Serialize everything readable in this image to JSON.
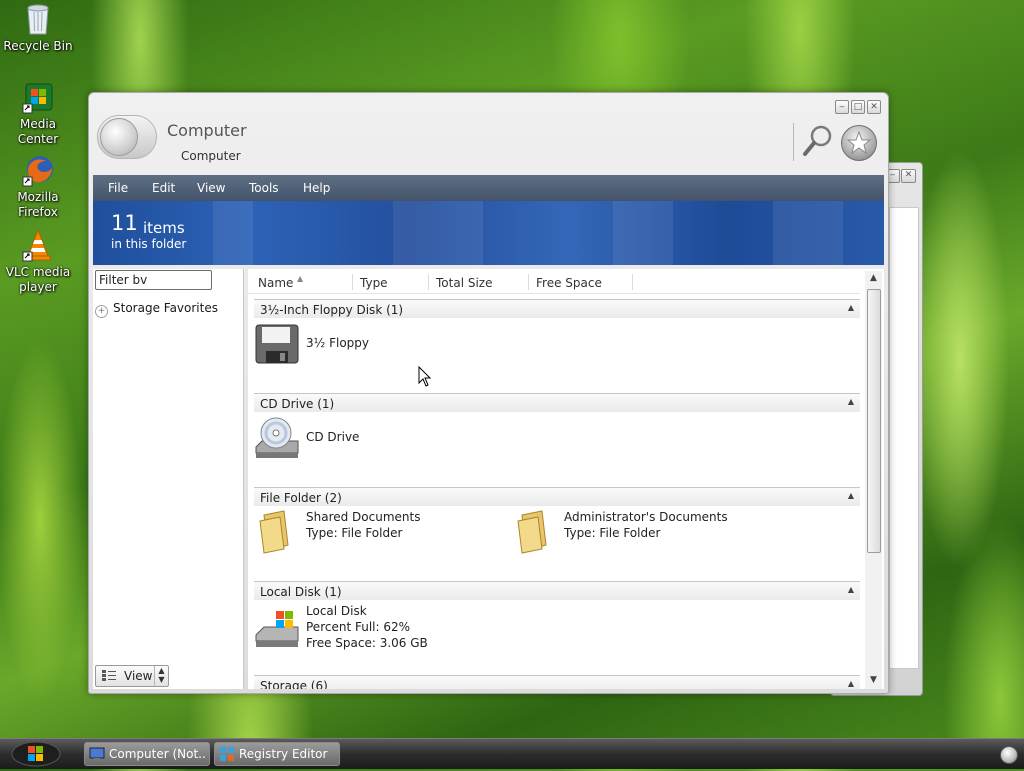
{
  "desktop": {
    "icons": [
      {
        "label": "Recycle Bin",
        "icon": "recycle-bin-icon"
      },
      {
        "label": "Media Center",
        "icon": "media-center-icon"
      },
      {
        "label": "Mozilla Firefox",
        "icon": "firefox-icon"
      },
      {
        "label": "VLC media player",
        "icon": "vlc-icon"
      }
    ]
  },
  "window": {
    "title": "Computer",
    "subtitle": "Computer",
    "menu": [
      "File",
      "Edit",
      "View",
      "Tools",
      "Help"
    ],
    "banner": {
      "count": "11",
      "count_label": "items",
      "folder_text": "in this folder"
    },
    "filter_placeholder": "Filter bv",
    "storage_favorites": "Storage Favorites",
    "view_button": "View",
    "columns": [
      "Name",
      "Type",
      "Total Size",
      "Free Space"
    ],
    "groups": [
      {
        "header": "3½-Inch Floppy Disk (1)",
        "items": [
          {
            "name": "3½ Floppy",
            "icon": "floppy-drive-icon"
          }
        ]
      },
      {
        "header": "CD Drive (1)",
        "items": [
          {
            "name": "CD Drive",
            "icon": "cd-drive-icon"
          }
        ]
      },
      {
        "header": "File Folder (2)",
        "items": [
          {
            "name": "Shared Documents",
            "detail": "Type: File Folder",
            "icon": "folder-icon"
          },
          {
            "name": "Administrator's Documents",
            "detail": "Type: File Folder",
            "icon": "folder-icon"
          }
        ]
      },
      {
        "header": "Local Disk (1)",
        "items": [
          {
            "name": "Local Disk",
            "detail": "Percent Full: 62%",
            "detail2": "Free Space: 3.06 GB",
            "icon": "local-disk-icon"
          }
        ]
      },
      {
        "header": "Storage (6)",
        "items": []
      }
    ]
  },
  "taskbar": {
    "tasks": [
      {
        "label": "Computer (Not...",
        "icon": "computer-icon"
      },
      {
        "label": "Registry Editor",
        "icon": "registry-editor-icon"
      }
    ]
  },
  "colors": {
    "menubar": "#4a5a70",
    "banner": "#2559a8",
    "taskbar": "#2d2d2d"
  }
}
